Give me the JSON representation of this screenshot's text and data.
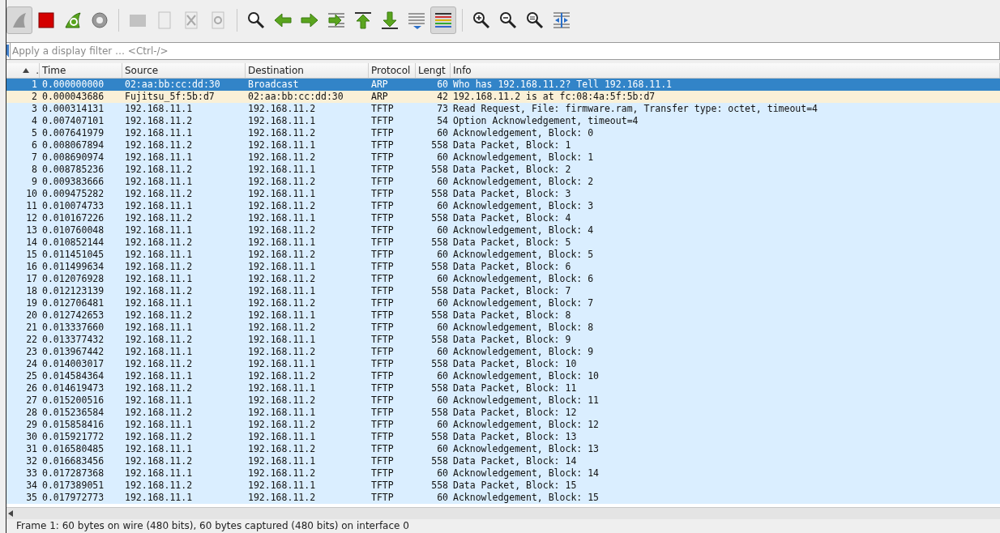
{
  "toolbar": [
    {
      "kind": "start",
      "pressed": true,
      "disabled": false
    },
    {
      "kind": "stop",
      "pressed": false,
      "disabled": false
    },
    {
      "kind": "restart",
      "pressed": false,
      "disabled": false
    },
    {
      "kind": "options",
      "pressed": false,
      "disabled": false
    },
    {
      "kind": "separator"
    },
    {
      "kind": "open",
      "pressed": false,
      "disabled": true
    },
    {
      "kind": "save",
      "pressed": false,
      "disabled": true
    },
    {
      "kind": "close",
      "pressed": false,
      "disabled": true
    },
    {
      "kind": "reload",
      "pressed": false,
      "disabled": true
    },
    {
      "kind": "separator"
    },
    {
      "kind": "find",
      "pressed": false,
      "disabled": false
    },
    {
      "kind": "back",
      "pressed": false,
      "disabled": false
    },
    {
      "kind": "forward",
      "pressed": false,
      "disabled": false
    },
    {
      "kind": "jump",
      "pressed": false,
      "disabled": false
    },
    {
      "kind": "first",
      "pressed": false,
      "disabled": false
    },
    {
      "kind": "last",
      "pressed": false,
      "disabled": false
    },
    {
      "kind": "autoscroll",
      "pressed": false,
      "disabled": false
    },
    {
      "kind": "colorize",
      "pressed": true,
      "disabled": false
    },
    {
      "kind": "separator"
    },
    {
      "kind": "zoom-in",
      "pressed": false,
      "disabled": false
    },
    {
      "kind": "zoom-out",
      "pressed": false,
      "disabled": false
    },
    {
      "kind": "zoom-normal",
      "pressed": false,
      "disabled": false
    },
    {
      "kind": "resize",
      "pressed": false,
      "disabled": false
    }
  ],
  "filter": {
    "placeholder": "Apply a display filter … <Ctrl-/>"
  },
  "table": {
    "columns": [
      {
        "label": ".",
        "sorted": true
      },
      {
        "label": "Time",
        "sorted": false
      },
      {
        "label": "Source",
        "sorted": false
      },
      {
        "label": "Destination",
        "sorted": false
      },
      {
        "label": "Protocol",
        "sorted": false
      },
      {
        "label": "Lengt",
        "sorted": false
      },
      {
        "label": "Info",
        "sorted": false
      }
    ],
    "rows": [
      {
        "cells": [
          "1",
          "0.000000000",
          "02:aa:bb:cc:dd:30",
          "Broadcast",
          "ARP",
          "60",
          "Who has 192.168.11.2? Tell 192.168.11.1"
        ],
        "selected": true
      },
      {
        "cells": [
          "2",
          "0.000043686",
          "Fujitsu_5f:5b:d7",
          "02:aa:bb:cc:dd:30",
          "ARP",
          "42",
          "192.168.11.2 is at fc:08:4a:5f:5b:d7"
        ],
        "selected": false,
        "color": "#faf0d7"
      },
      {
        "cells": [
          "3",
          "0.000314131",
          "192.168.11.1",
          "192.168.11.2",
          "TFTP",
          "73",
          "Read Request, File: firmware.ram, Transfer type: octet, timeout=4"
        ],
        "selected": false,
        "color": "#daeeff"
      },
      {
        "cells": [
          "4",
          "0.007407101",
          "192.168.11.2",
          "192.168.11.1",
          "TFTP",
          "54",
          "Option Acknowledgement, timeout=4"
        ],
        "selected": false,
        "color": "#daeeff"
      },
      {
        "cells": [
          "5",
          "0.007641979",
          "192.168.11.1",
          "192.168.11.2",
          "TFTP",
          "60",
          "Acknowledgement, Block: 0"
        ],
        "selected": false,
        "color": "#daeeff"
      },
      {
        "cells": [
          "6",
          "0.008067894",
          "192.168.11.2",
          "192.168.11.1",
          "TFTP",
          "558",
          "Data Packet, Block: 1"
        ],
        "selected": false,
        "color": "#daeeff"
      },
      {
        "cells": [
          "7",
          "0.008690974",
          "192.168.11.1",
          "192.168.11.2",
          "TFTP",
          "60",
          "Acknowledgement, Block: 1"
        ],
        "selected": false,
        "color": "#daeeff"
      },
      {
        "cells": [
          "8",
          "0.008785236",
          "192.168.11.2",
          "192.168.11.1",
          "TFTP",
          "558",
          "Data Packet, Block: 2"
        ],
        "selected": false,
        "color": "#daeeff"
      },
      {
        "cells": [
          "9",
          "0.009383666",
          "192.168.11.1",
          "192.168.11.2",
          "TFTP",
          "60",
          "Acknowledgement, Block: 2"
        ],
        "selected": false,
        "color": "#daeeff"
      },
      {
        "cells": [
          "10",
          "0.009475282",
          "192.168.11.2",
          "192.168.11.1",
          "TFTP",
          "558",
          "Data Packet, Block: 3"
        ],
        "selected": false,
        "color": "#daeeff"
      },
      {
        "cells": [
          "11",
          "0.010074733",
          "192.168.11.1",
          "192.168.11.2",
          "TFTP",
          "60",
          "Acknowledgement, Block: 3"
        ],
        "selected": false,
        "color": "#daeeff"
      },
      {
        "cells": [
          "12",
          "0.010167226",
          "192.168.11.2",
          "192.168.11.1",
          "TFTP",
          "558",
          "Data Packet, Block: 4"
        ],
        "selected": false,
        "color": "#daeeff"
      },
      {
        "cells": [
          "13",
          "0.010760048",
          "192.168.11.1",
          "192.168.11.2",
          "TFTP",
          "60",
          "Acknowledgement, Block: 4"
        ],
        "selected": false,
        "color": "#daeeff"
      },
      {
        "cells": [
          "14",
          "0.010852144",
          "192.168.11.2",
          "192.168.11.1",
          "TFTP",
          "558",
          "Data Packet, Block: 5"
        ],
        "selected": false,
        "color": "#daeeff"
      },
      {
        "cells": [
          "15",
          "0.011451045",
          "192.168.11.1",
          "192.168.11.2",
          "TFTP",
          "60",
          "Acknowledgement, Block: 5"
        ],
        "selected": false,
        "color": "#daeeff"
      },
      {
        "cells": [
          "16",
          "0.011499634",
          "192.168.11.2",
          "192.168.11.1",
          "TFTP",
          "558",
          "Data Packet, Block: 6"
        ],
        "selected": false,
        "color": "#daeeff"
      },
      {
        "cells": [
          "17",
          "0.012076928",
          "192.168.11.1",
          "192.168.11.2",
          "TFTP",
          "60",
          "Acknowledgement, Block: 6"
        ],
        "selected": false,
        "color": "#daeeff"
      },
      {
        "cells": [
          "18",
          "0.012123139",
          "192.168.11.2",
          "192.168.11.1",
          "TFTP",
          "558",
          "Data Packet, Block: 7"
        ],
        "selected": false,
        "color": "#daeeff"
      },
      {
        "cells": [
          "19",
          "0.012706481",
          "192.168.11.1",
          "192.168.11.2",
          "TFTP",
          "60",
          "Acknowledgement, Block: 7"
        ],
        "selected": false,
        "color": "#daeeff"
      },
      {
        "cells": [
          "20",
          "0.012742653",
          "192.168.11.2",
          "192.168.11.1",
          "TFTP",
          "558",
          "Data Packet, Block: 8"
        ],
        "selected": false,
        "color": "#daeeff"
      },
      {
        "cells": [
          "21",
          "0.013337660",
          "192.168.11.1",
          "192.168.11.2",
          "TFTP",
          "60",
          "Acknowledgement, Block: 8"
        ],
        "selected": false,
        "color": "#daeeff"
      },
      {
        "cells": [
          "22",
          "0.013377432",
          "192.168.11.2",
          "192.168.11.1",
          "TFTP",
          "558",
          "Data Packet, Block: 9"
        ],
        "selected": false,
        "color": "#daeeff"
      },
      {
        "cells": [
          "23",
          "0.013967442",
          "192.168.11.1",
          "192.168.11.2",
          "TFTP",
          "60",
          "Acknowledgement, Block: 9"
        ],
        "selected": false,
        "color": "#daeeff"
      },
      {
        "cells": [
          "24",
          "0.014003017",
          "192.168.11.2",
          "192.168.11.1",
          "TFTP",
          "558",
          "Data Packet, Block: 10"
        ],
        "selected": false,
        "color": "#daeeff"
      },
      {
        "cells": [
          "25",
          "0.014584364",
          "192.168.11.1",
          "192.168.11.2",
          "TFTP",
          "60",
          "Acknowledgement, Block: 10"
        ],
        "selected": false,
        "color": "#daeeff"
      },
      {
        "cells": [
          "26",
          "0.014619473",
          "192.168.11.2",
          "192.168.11.1",
          "TFTP",
          "558",
          "Data Packet, Block: 11"
        ],
        "selected": false,
        "color": "#daeeff"
      },
      {
        "cells": [
          "27",
          "0.015200516",
          "192.168.11.1",
          "192.168.11.2",
          "TFTP",
          "60",
          "Acknowledgement, Block: 11"
        ],
        "selected": false,
        "color": "#daeeff"
      },
      {
        "cells": [
          "28",
          "0.015236584",
          "192.168.11.2",
          "192.168.11.1",
          "TFTP",
          "558",
          "Data Packet, Block: 12"
        ],
        "selected": false,
        "color": "#daeeff"
      },
      {
        "cells": [
          "29",
          "0.015858416",
          "192.168.11.1",
          "192.168.11.2",
          "TFTP",
          "60",
          "Acknowledgement, Block: 12"
        ],
        "selected": false,
        "color": "#daeeff"
      },
      {
        "cells": [
          "30",
          "0.015921772",
          "192.168.11.2",
          "192.168.11.1",
          "TFTP",
          "558",
          "Data Packet, Block: 13"
        ],
        "selected": false,
        "color": "#daeeff"
      },
      {
        "cells": [
          "31",
          "0.016580485",
          "192.168.11.1",
          "192.168.11.2",
          "TFTP",
          "60",
          "Acknowledgement, Block: 13"
        ],
        "selected": false,
        "color": "#daeeff"
      },
      {
        "cells": [
          "32",
          "0.016683456",
          "192.168.11.2",
          "192.168.11.1",
          "TFTP",
          "558",
          "Data Packet, Block: 14"
        ],
        "selected": false,
        "color": "#daeeff"
      },
      {
        "cells": [
          "33",
          "0.017287368",
          "192.168.11.1",
          "192.168.11.2",
          "TFTP",
          "60",
          "Acknowledgement, Block: 14"
        ],
        "selected": false,
        "color": "#daeeff"
      },
      {
        "cells": [
          "34",
          "0.017389051",
          "192.168.11.2",
          "192.168.11.1",
          "TFTP",
          "558",
          "Data Packet, Block: 15"
        ],
        "selected": false,
        "color": "#daeeff"
      },
      {
        "cells": [
          "35",
          "0.017972773",
          "192.168.11.1",
          "192.168.11.2",
          "TFTP",
          "60",
          "Acknowledgement, Block: 15"
        ],
        "selected": false,
        "color": "#daeeff"
      }
    ]
  },
  "status_bar": "Frame 1: 60 bytes on wire (480 bits), 60 bytes captured (480 bits) on interface 0"
}
